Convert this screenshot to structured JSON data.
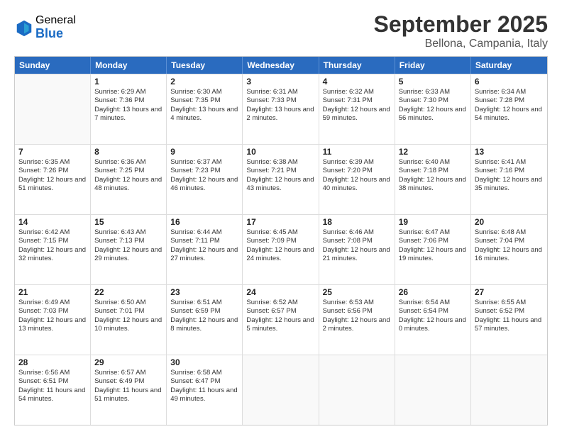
{
  "logo": {
    "general": "General",
    "blue": "Blue"
  },
  "header": {
    "month": "September 2025",
    "location": "Bellona, Campania, Italy"
  },
  "days_of_week": [
    "Sunday",
    "Monday",
    "Tuesday",
    "Wednesday",
    "Thursday",
    "Friday",
    "Saturday"
  ],
  "weeks": [
    [
      {
        "day": "",
        "sunrise": "",
        "sunset": "",
        "daylight": ""
      },
      {
        "day": "1",
        "sunrise": "Sunrise: 6:29 AM",
        "sunset": "Sunset: 7:36 PM",
        "daylight": "Daylight: 13 hours and 7 minutes."
      },
      {
        "day": "2",
        "sunrise": "Sunrise: 6:30 AM",
        "sunset": "Sunset: 7:35 PM",
        "daylight": "Daylight: 13 hours and 4 minutes."
      },
      {
        "day": "3",
        "sunrise": "Sunrise: 6:31 AM",
        "sunset": "Sunset: 7:33 PM",
        "daylight": "Daylight: 13 hours and 2 minutes."
      },
      {
        "day": "4",
        "sunrise": "Sunrise: 6:32 AM",
        "sunset": "Sunset: 7:31 PM",
        "daylight": "Daylight: 12 hours and 59 minutes."
      },
      {
        "day": "5",
        "sunrise": "Sunrise: 6:33 AM",
        "sunset": "Sunset: 7:30 PM",
        "daylight": "Daylight: 12 hours and 56 minutes."
      },
      {
        "day": "6",
        "sunrise": "Sunrise: 6:34 AM",
        "sunset": "Sunset: 7:28 PM",
        "daylight": "Daylight: 12 hours and 54 minutes."
      }
    ],
    [
      {
        "day": "7",
        "sunrise": "Sunrise: 6:35 AM",
        "sunset": "Sunset: 7:26 PM",
        "daylight": "Daylight: 12 hours and 51 minutes."
      },
      {
        "day": "8",
        "sunrise": "Sunrise: 6:36 AM",
        "sunset": "Sunset: 7:25 PM",
        "daylight": "Daylight: 12 hours and 48 minutes."
      },
      {
        "day": "9",
        "sunrise": "Sunrise: 6:37 AM",
        "sunset": "Sunset: 7:23 PM",
        "daylight": "Daylight: 12 hours and 46 minutes."
      },
      {
        "day": "10",
        "sunrise": "Sunrise: 6:38 AM",
        "sunset": "Sunset: 7:21 PM",
        "daylight": "Daylight: 12 hours and 43 minutes."
      },
      {
        "day": "11",
        "sunrise": "Sunrise: 6:39 AM",
        "sunset": "Sunset: 7:20 PM",
        "daylight": "Daylight: 12 hours and 40 minutes."
      },
      {
        "day": "12",
        "sunrise": "Sunrise: 6:40 AM",
        "sunset": "Sunset: 7:18 PM",
        "daylight": "Daylight: 12 hours and 38 minutes."
      },
      {
        "day": "13",
        "sunrise": "Sunrise: 6:41 AM",
        "sunset": "Sunset: 7:16 PM",
        "daylight": "Daylight: 12 hours and 35 minutes."
      }
    ],
    [
      {
        "day": "14",
        "sunrise": "Sunrise: 6:42 AM",
        "sunset": "Sunset: 7:15 PM",
        "daylight": "Daylight: 12 hours and 32 minutes."
      },
      {
        "day": "15",
        "sunrise": "Sunrise: 6:43 AM",
        "sunset": "Sunset: 7:13 PM",
        "daylight": "Daylight: 12 hours and 29 minutes."
      },
      {
        "day": "16",
        "sunrise": "Sunrise: 6:44 AM",
        "sunset": "Sunset: 7:11 PM",
        "daylight": "Daylight: 12 hours and 27 minutes."
      },
      {
        "day": "17",
        "sunrise": "Sunrise: 6:45 AM",
        "sunset": "Sunset: 7:09 PM",
        "daylight": "Daylight: 12 hours and 24 minutes."
      },
      {
        "day": "18",
        "sunrise": "Sunrise: 6:46 AM",
        "sunset": "Sunset: 7:08 PM",
        "daylight": "Daylight: 12 hours and 21 minutes."
      },
      {
        "day": "19",
        "sunrise": "Sunrise: 6:47 AM",
        "sunset": "Sunset: 7:06 PM",
        "daylight": "Daylight: 12 hours and 19 minutes."
      },
      {
        "day": "20",
        "sunrise": "Sunrise: 6:48 AM",
        "sunset": "Sunset: 7:04 PM",
        "daylight": "Daylight: 12 hours and 16 minutes."
      }
    ],
    [
      {
        "day": "21",
        "sunrise": "Sunrise: 6:49 AM",
        "sunset": "Sunset: 7:03 PM",
        "daylight": "Daylight: 12 hours and 13 minutes."
      },
      {
        "day": "22",
        "sunrise": "Sunrise: 6:50 AM",
        "sunset": "Sunset: 7:01 PM",
        "daylight": "Daylight: 12 hours and 10 minutes."
      },
      {
        "day": "23",
        "sunrise": "Sunrise: 6:51 AM",
        "sunset": "Sunset: 6:59 PM",
        "daylight": "Daylight: 12 hours and 8 minutes."
      },
      {
        "day": "24",
        "sunrise": "Sunrise: 6:52 AM",
        "sunset": "Sunset: 6:57 PM",
        "daylight": "Daylight: 12 hours and 5 minutes."
      },
      {
        "day": "25",
        "sunrise": "Sunrise: 6:53 AM",
        "sunset": "Sunset: 6:56 PM",
        "daylight": "Daylight: 12 hours and 2 minutes."
      },
      {
        "day": "26",
        "sunrise": "Sunrise: 6:54 AM",
        "sunset": "Sunset: 6:54 PM",
        "daylight": "Daylight: 12 hours and 0 minutes."
      },
      {
        "day": "27",
        "sunrise": "Sunrise: 6:55 AM",
        "sunset": "Sunset: 6:52 PM",
        "daylight": "Daylight: 11 hours and 57 minutes."
      }
    ],
    [
      {
        "day": "28",
        "sunrise": "Sunrise: 6:56 AM",
        "sunset": "Sunset: 6:51 PM",
        "daylight": "Daylight: 11 hours and 54 minutes."
      },
      {
        "day": "29",
        "sunrise": "Sunrise: 6:57 AM",
        "sunset": "Sunset: 6:49 PM",
        "daylight": "Daylight: 11 hours and 51 minutes."
      },
      {
        "day": "30",
        "sunrise": "Sunrise: 6:58 AM",
        "sunset": "Sunset: 6:47 PM",
        "daylight": "Daylight: 11 hours and 49 minutes."
      },
      {
        "day": "",
        "sunrise": "",
        "sunset": "",
        "daylight": ""
      },
      {
        "day": "",
        "sunrise": "",
        "sunset": "",
        "daylight": ""
      },
      {
        "day": "",
        "sunrise": "",
        "sunset": "",
        "daylight": ""
      },
      {
        "day": "",
        "sunrise": "",
        "sunset": "",
        "daylight": ""
      }
    ]
  ]
}
